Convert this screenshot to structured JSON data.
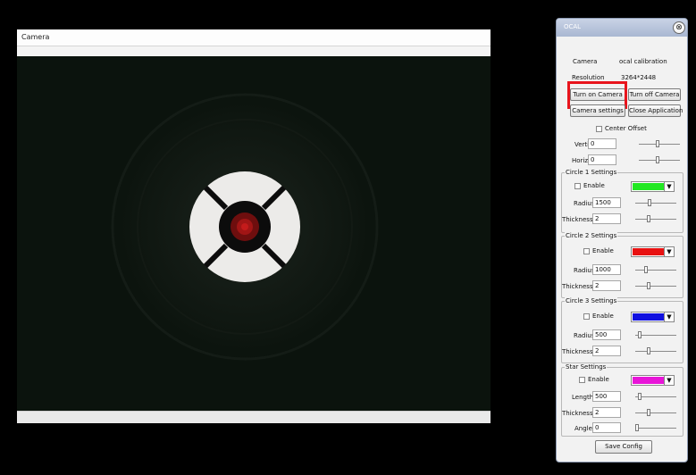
{
  "camera_window": {
    "title": "Camera"
  },
  "panel": {
    "title": "OCAL",
    "close_icon": "⊗",
    "camera_label": "Camera",
    "camera_value": "ocal calibration",
    "resolution_label": "Resolution",
    "resolution_value": "3264*2448",
    "turn_on_label": "Turn on Camera",
    "turn_off_label": "Turn off Camera",
    "camera_settings_label": "Camera settings",
    "close_app_label": "Close Application",
    "center_offset_label": "Center Offset",
    "vertical_label": "Vertical",
    "vertical_value": "0",
    "horizontal_label": "Horizontal",
    "horizontal_value": "0",
    "circle1": {
      "title": "Circle 1 Settings",
      "enable_label": "Enable",
      "color": "#22e822",
      "radius_label": "Radius",
      "radius_value": "1500",
      "thickness_label": "Thickness",
      "thickness_value": "2"
    },
    "circle2": {
      "title": "Circle 2 Settings",
      "enable_label": "Enable",
      "color": "#e81111",
      "radius_label": "Radius",
      "radius_value": "1000",
      "thickness_label": "Thickness",
      "thickness_value": "2"
    },
    "circle3": {
      "title": "Circle 3 Settings",
      "enable_label": "Enable",
      "color": "#1010e0",
      "radius_label": "Radius",
      "radius_value": "500",
      "thickness_label": "Thickness",
      "thickness_value": "2"
    },
    "star": {
      "title": "Star Settings",
      "enable_label": "Enable",
      "color": "#e815d8",
      "length_label": "Length",
      "length_value": "500",
      "thickness_label": "Thickness",
      "thickness_value": "2",
      "angle_label": "Angle",
      "angle_value": "0"
    },
    "save_label": "Save Config",
    "highlight_color": "#e8141c"
  }
}
